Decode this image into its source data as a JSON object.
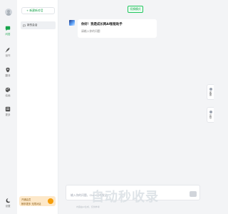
{
  "rail": {
    "items": [
      {
        "label": "问答",
        "icon": "chat-icon",
        "active": true
      },
      {
        "label": "创作",
        "icon": "feather-icon",
        "active": false
      },
      {
        "label": "翻译",
        "icon": "translate-icon",
        "active": false
      },
      {
        "label": "绘画",
        "icon": "palette-icon",
        "active": false
      },
      {
        "label": "更多",
        "icon": "grid-icon",
        "active": false
      },
      {
        "label": "设置",
        "icon": "moon-icon",
        "active": false
      }
    ]
  },
  "convo": {
    "new_chat_label": "+ 新建新对话",
    "items": [
      {
        "label": "新的会话"
      }
    ],
    "promo": {
      "line1": "开通会员",
      "line2": "畅享更多 无限对话"
    }
  },
  "main": {
    "top_button_label": "切换模式",
    "greeting": "你好！我是成长网AI智能助手",
    "prompt_hint": "请输入你的问题",
    "input_placeholder": "输入你的问题，Ctrl+回车发送",
    "watermark": "自动秒收录",
    "disclaimer": "内容由AI生成，仅供参考"
  },
  "side_tabs": [
    {
      "label": "客服"
    },
    {
      "label": "反馈"
    }
  ]
}
